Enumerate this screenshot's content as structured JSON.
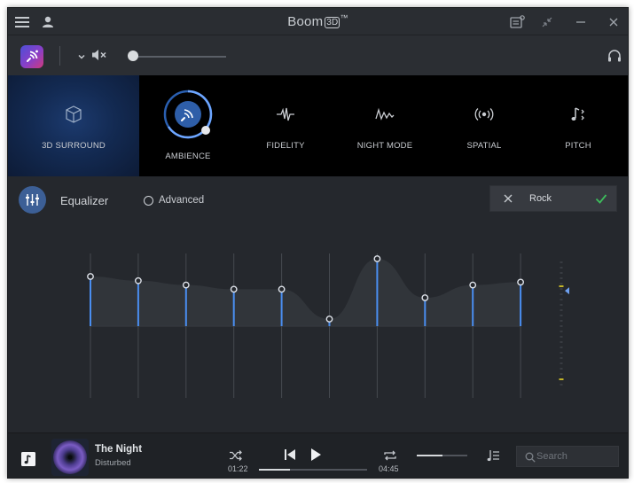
{
  "window": {
    "title": "Boom",
    "title_badge": "3D",
    "title_tm": "™"
  },
  "icons": {
    "menu": "hamburger-menu-icon",
    "account": "user-icon",
    "notes": "notes-icon",
    "shrink": "shrink-icon",
    "minimize": "minimize-icon",
    "close": "close-icon",
    "app_logo": "boom-logo-icon",
    "volume_dropdown": "chevron-down-icon",
    "mute": "speaker-mute-icon",
    "headphones": "headphones-icon",
    "library": "music-library-icon",
    "shuffle": "shuffle-icon",
    "previous": "skip-previous-icon",
    "play": "play-icon",
    "repeat": "repeat-icon",
    "playlist": "playlist-icon",
    "search": "search-icon"
  },
  "effects": {
    "surround_label": "3D SURROUND",
    "ambience_label": "AMBIENCE",
    "fidelity_label": "FIDELITY",
    "night_label": "NIGHT MODE",
    "spatial_label": "SPATIAL",
    "pitch_label": "PITCH",
    "active": "AMBIENCE"
  },
  "equalizer": {
    "title": "Equalizer",
    "advanced_label": "Advanced",
    "preset_name": "Rock",
    "bands": [
      0.7,
      0.64,
      0.58,
      0.52,
      0.52,
      0.1,
      0.95,
      0.4,
      0.58,
      0.62
    ],
    "level_meter_position": 0.45
  },
  "player": {
    "track_title": "The Night",
    "track_artist": "Disturbed",
    "time_current": "01:22",
    "time_total": "04:45",
    "progress": 0.29,
    "volume": 0.5,
    "search_placeholder": "Search"
  },
  "colors": {
    "accent": "#4a8ef0",
    "check": "#3dbd5c",
    "surround_bg": "#15305e",
    "meter": "#c2b428"
  }
}
